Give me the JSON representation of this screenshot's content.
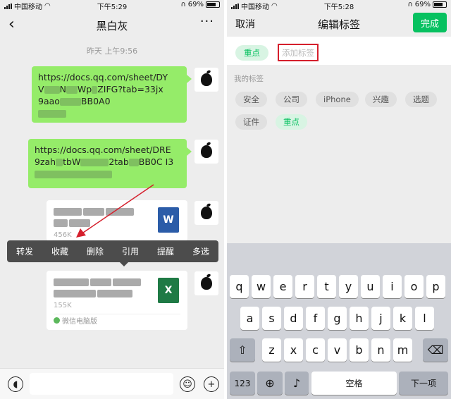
{
  "left": {
    "status": {
      "carrier": "中国移动",
      "time": "下午5:29",
      "battery": "69%"
    },
    "nav": {
      "back": "‹",
      "title": "黑白灰",
      "more": "···"
    },
    "timestamp": "昨天 上午9:56",
    "messages": [
      {
        "type": "text",
        "line1": "https://docs.qq.com/sheet/DY",
        "line2a": "V",
        "line2b": "N",
        "line2c": "Wp",
        "line2d": "ZIFG",
        "line2e": "?tab=33jx",
        "line3a": "9aao",
        "line3b": "BB0A0"
      },
      {
        "type": "text",
        "line1": "https://docs.qq.com/sheet/DRE",
        "line2a": "9zah",
        "line2b": "tbW",
        "line2c": "2tab",
        "line2d": "BB0C I3"
      },
      {
        "type": "file",
        "size": "456K",
        "icon": "W"
      },
      {
        "type": "file",
        "size": "155K",
        "icon": "X",
        "source": "微信电脑版"
      }
    ],
    "context_menu": [
      "转发",
      "收藏",
      "删除",
      "引用",
      "提醒",
      "多选"
    ]
  },
  "right": {
    "status": {
      "carrier": "中国移动",
      "time": "下午5:28",
      "battery": "69%"
    },
    "nav": {
      "cancel": "取消",
      "title": "编辑标签",
      "done": "完成"
    },
    "selected_tag": "重点",
    "add_placeholder": "添加标签",
    "section_label": "我的标签",
    "tags": [
      "安全",
      "公司",
      "iPhone",
      "兴趣",
      "选题",
      "证件",
      "重点"
    ],
    "keys_row1": [
      "q",
      "w",
      "e",
      "r",
      "t",
      "y",
      "u",
      "i",
      "o",
      "p"
    ],
    "keys_row2": [
      "a",
      "s",
      "d",
      "f",
      "g",
      "h",
      "j",
      "k",
      "l"
    ],
    "keys_row3": [
      "z",
      "x",
      "c",
      "v",
      "b",
      "n",
      "m"
    ],
    "key_123": "123",
    "key_space": "空格",
    "key_next": "下一项"
  },
  "colors": {
    "wechat_green": "#07c160",
    "bubble_green": "#95ec69",
    "highlight_red": "#d51f2c"
  }
}
